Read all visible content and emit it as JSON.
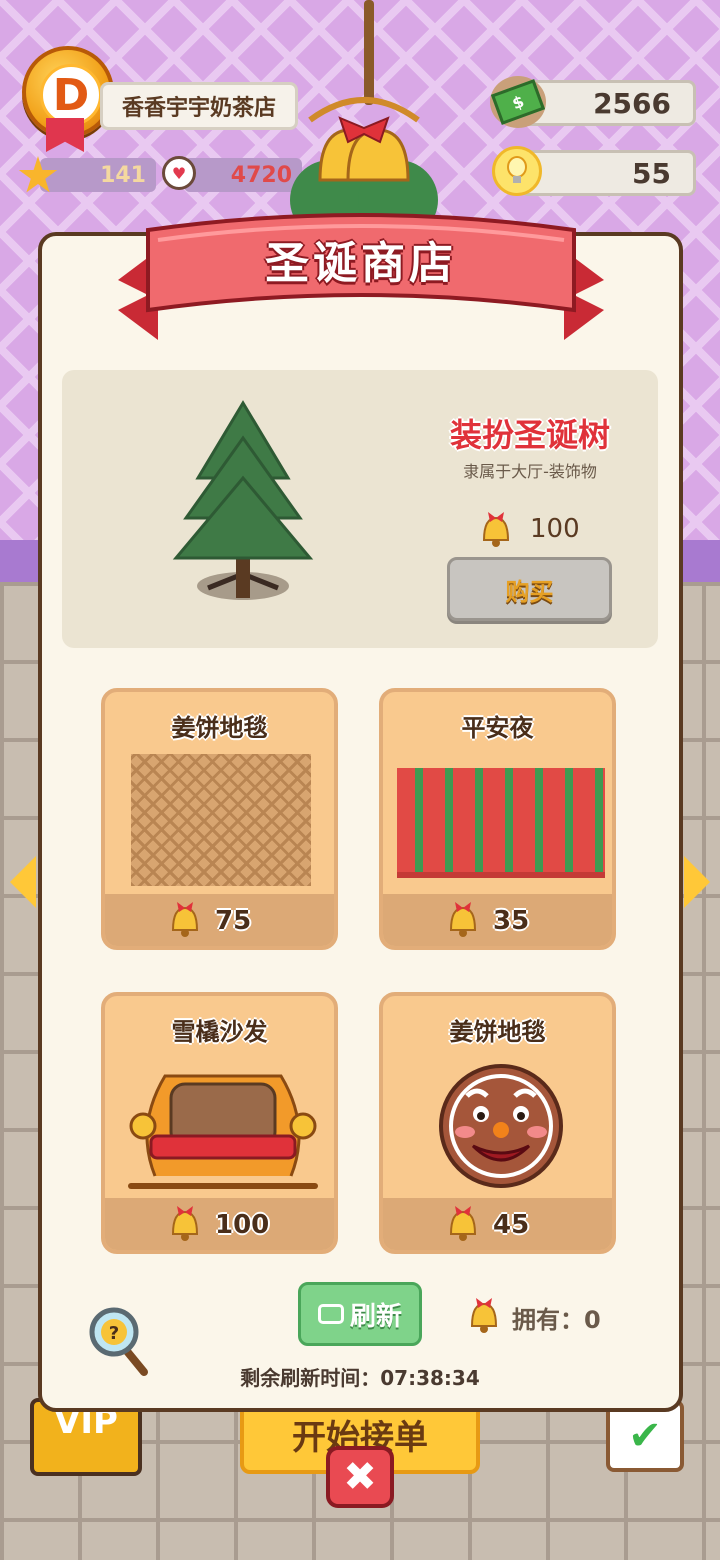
{
  "hud": {
    "rank_letter": "D",
    "shop_name": "香香宇宇奶茶店",
    "stars": "141",
    "popularity": "4720",
    "cash": "2566",
    "ideas": "55"
  },
  "background": {
    "vip_label": "VIP",
    "start_label": "开始接单"
  },
  "shop": {
    "title": "圣诞商店",
    "featured": {
      "name": "装扮圣诞树",
      "category": "隶属于大厅-装饰物",
      "price": "100",
      "buy_label": "购买"
    },
    "items": [
      {
        "name": "姜饼地毯",
        "price": "75"
      },
      {
        "name": "平安夜",
        "price": "35"
      },
      {
        "name": "雪橇沙发",
        "price": "100"
      },
      {
        "name": "姜饼地毯",
        "price": "45"
      }
    ],
    "refresh_label": "刷新",
    "owned_text": "拥有：0",
    "timer_text": "剩余刷新时间：07:38:34"
  },
  "colors": {
    "accent_red": "#e0323a",
    "panel_bg": "#fbf6ea",
    "card_bg": "#f9c98e",
    "refresh_green": "#7fd38a"
  },
  "icons": [
    "rank-badge-icon",
    "star-icon",
    "angel-icon",
    "cash-icon",
    "bulb-icon",
    "bell-icon",
    "tv-icon",
    "magnifier-question-icon",
    "close-icon",
    "check-icon",
    "arrow-left-icon",
    "arrow-right-icon"
  ]
}
